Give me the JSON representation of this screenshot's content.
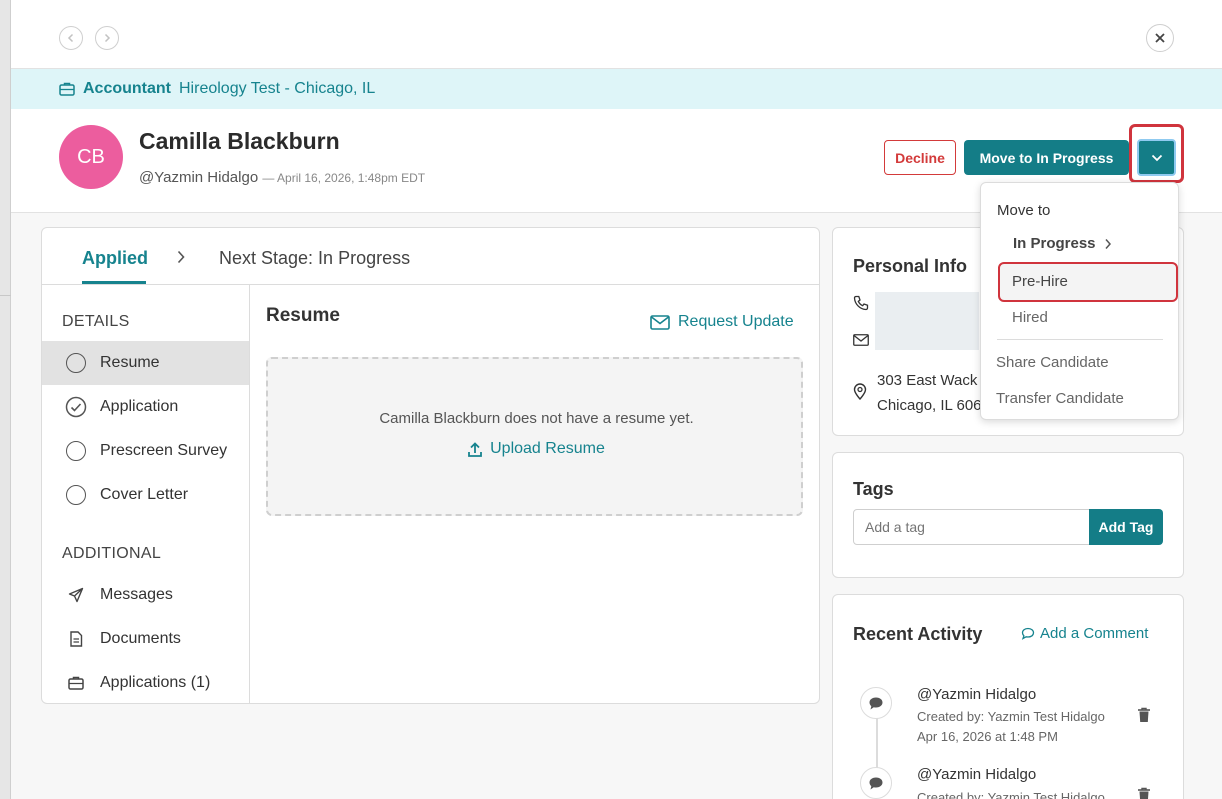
{
  "job": {
    "title": "Accountant",
    "location": "Hireology Test - Chicago, IL"
  },
  "candidate": {
    "initials": "CB",
    "name": "Camilla Blackburn",
    "handle": "@Yazmin Hidalgo",
    "date": "— April 16, 2026, 1:48pm EDT"
  },
  "actions": {
    "decline": "Decline",
    "move": "Move to In Progress"
  },
  "dropdown": {
    "header": "Move to",
    "in_progress": "In Progress",
    "pre_hire": "Pre-Hire",
    "hired": "Hired",
    "share": "Share Candidate",
    "transfer": "Transfer Candidate"
  },
  "tabs": {
    "current": "Applied",
    "next": "Next Stage: In Progress"
  },
  "sidebar": {
    "details_header": "DETAILS",
    "details": [
      {
        "label": "Resume"
      },
      {
        "label": "Application"
      },
      {
        "label": "Prescreen Survey"
      },
      {
        "label": "Cover Letter"
      }
    ],
    "additional_header": "ADDITIONAL",
    "additional": [
      {
        "label": "Messages"
      },
      {
        "label": "Documents"
      },
      {
        "label": "Applications (1)"
      }
    ]
  },
  "resume": {
    "title": "Resume",
    "request_update": "Request Update",
    "empty_text": "Camilla Blackburn does not have a resume yet.",
    "upload": "Upload Resume"
  },
  "personal_info": {
    "title": "Personal Info",
    "address_line1": "303 East Wack",
    "address_line2": "Chicago, IL 606"
  },
  "tags": {
    "title": "Tags",
    "placeholder": "Add a tag",
    "button": "Add Tag"
  },
  "activity": {
    "title": "Recent Activity",
    "add_comment": "Add a Comment",
    "items": [
      {
        "user": "@Yazmin Hidalgo",
        "created_by": "Created by: Yazmin Test Hidalgo",
        "date": "Apr 16, 2026 at 1:48 PM"
      },
      {
        "user": "@Yazmin Hidalgo",
        "created_by": "Created by: Yazmin Test Hidalgo"
      }
    ]
  },
  "colors": {
    "primary": "#147d87",
    "accent_text": "#16838e",
    "danger": "#d33a3a",
    "avatar": "#ec5d9e",
    "banner_bg": "#def5f8"
  }
}
